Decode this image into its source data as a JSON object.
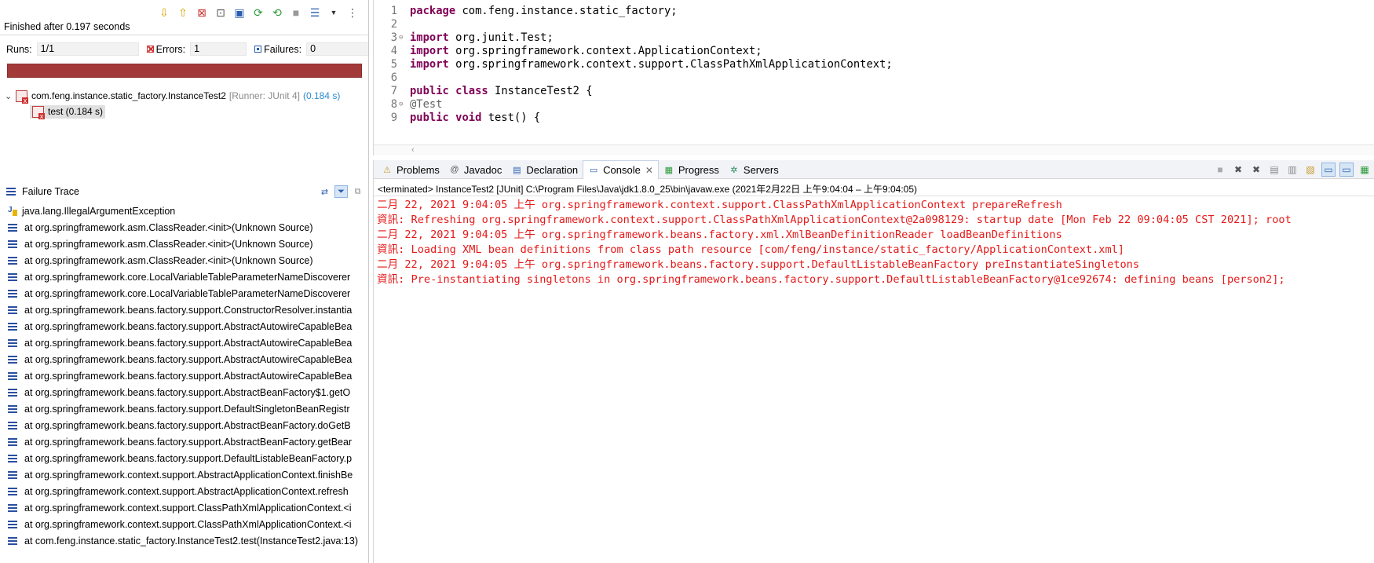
{
  "junit": {
    "finished": "Finished after 0.197 seconds",
    "runs_label": "Runs:",
    "runs_value": "1/1",
    "errors_label": "Errors:",
    "errors_value": "1",
    "failures_label": "Failures:",
    "failures_value": "0",
    "progress_color": "#a33a3a",
    "suite_name": "com.feng.instance.static_factory.InstanceTest2",
    "suite_runner": "[Runner: JUnit 4]",
    "suite_time": "(0.184 s)",
    "test_label": "test (0.184 s)",
    "trace_title": "Failure Trace",
    "exception": "java.lang.IllegalArgumentException",
    "trace": [
      "at org.springframework.asm.ClassReader.<init>(Unknown Source)",
      "at org.springframework.asm.ClassReader.<init>(Unknown Source)",
      "at org.springframework.asm.ClassReader.<init>(Unknown Source)",
      "at org.springframework.core.LocalVariableTableParameterNameDiscoverer",
      "at org.springframework.core.LocalVariableTableParameterNameDiscoverer",
      "at org.springframework.beans.factory.support.ConstructorResolver.instantia",
      "at org.springframework.beans.factory.support.AbstractAutowireCapableBea",
      "at org.springframework.beans.factory.support.AbstractAutowireCapableBea",
      "at org.springframework.beans.factory.support.AbstractAutowireCapableBea",
      "at org.springframework.beans.factory.support.AbstractAutowireCapableBea",
      "at org.springframework.beans.factory.support.AbstractBeanFactory$1.getO",
      "at org.springframework.beans.factory.support.DefaultSingletonBeanRegistr",
      "at org.springframework.beans.factory.support.AbstractBeanFactory.doGetB",
      "at org.springframework.beans.factory.support.AbstractBeanFactory.getBear",
      "at org.springframework.beans.factory.support.DefaultListableBeanFactory.p",
      "at org.springframework.context.support.AbstractApplicationContext.finishBe",
      "at org.springframework.context.support.AbstractApplicationContext.refresh",
      "at org.springframework.context.support.ClassPathXmlApplicationContext.<i",
      "at org.springframework.context.support.ClassPathXmlApplicationContext.<i",
      "at com.feng.instance.static_factory.InstanceTest2.test(InstanceTest2.java:13)"
    ]
  },
  "editor": {
    "lines": [
      {
        "num": "1",
        "parts": [
          {
            "t": "package",
            "c": "kw"
          },
          {
            "t": " com.feng.instance.static_factory;",
            "c": ""
          }
        ]
      },
      {
        "num": "2",
        "parts": []
      },
      {
        "num": "3",
        "fold": true,
        "parts": [
          {
            "t": "import",
            "c": "kw"
          },
          {
            "t": " org.junit.Test;",
            "c": ""
          }
        ]
      },
      {
        "num": "4",
        "parts": [
          {
            "t": "import",
            "c": "kw"
          },
          {
            "t": " org.springframework.context.ApplicationContext;",
            "c": ""
          }
        ]
      },
      {
        "num": "5",
        "parts": [
          {
            "t": "import",
            "c": "kw"
          },
          {
            "t": " org.springframework.context.support.ClassPathXmlApplicationContext;",
            "c": ""
          }
        ]
      },
      {
        "num": "6",
        "parts": []
      },
      {
        "num": "7",
        "parts": [
          {
            "t": "public",
            "c": "kw"
          },
          {
            "t": " ",
            "c": ""
          },
          {
            "t": "class",
            "c": "kw"
          },
          {
            "t": " InstanceTest2 {",
            "c": ""
          }
        ]
      },
      {
        "num": "8",
        "fold": true,
        "parts": [
          {
            "t": "@Test",
            "c": "anno"
          }
        ]
      },
      {
        "num": "9",
        "parts": [
          {
            "t": "public",
            "c": "kw"
          },
          {
            "t": " ",
            "c": ""
          },
          {
            "t": "void",
            "c": "kw"
          },
          {
            "t": " test() {",
            "c": ""
          }
        ]
      }
    ]
  },
  "console": {
    "tabs": [
      {
        "label": "Problems",
        "icon": "problems-icon",
        "glyph": "⚠"
      },
      {
        "label": "Javadoc",
        "icon": "javadoc-icon",
        "glyph": "@"
      },
      {
        "label": "Declaration",
        "icon": "declaration-icon",
        "glyph": "▤"
      },
      {
        "label": "Console",
        "icon": "console-icon",
        "glyph": "▭",
        "active": true
      },
      {
        "label": "Progress",
        "icon": "progress-icon",
        "glyph": "▦"
      },
      {
        "label": "Servers",
        "icon": "servers-icon",
        "glyph": "✲"
      }
    ],
    "terminated": "<terminated> InstanceTest2 [JUnit] C:\\Program Files\\Java\\jdk1.8.0_25\\bin\\javaw.exe  (2021年2月22日 上午9:04:04 – 上午9:04:05)",
    "lines": [
      "二月 22, 2021 9:04:05 上午 org.springframework.context.support.ClassPathXmlApplicationContext prepareRefresh",
      "資訊: Refreshing org.springframework.context.support.ClassPathXmlApplicationContext@2a098129: startup date [Mon Feb 22 09:04:05 CST 2021]; root",
      "二月 22, 2021 9:04:05 上午 org.springframework.beans.factory.xml.XmlBeanDefinitionReader loadBeanDefinitions",
      "資訊: Loading XML bean definitions from class path resource [com/feng/instance/static_factory/ApplicationContext.xml]",
      "二月 22, 2021 9:04:05 上午 org.springframework.beans.factory.support.DefaultListableBeanFactory preInstantiateSingletons",
      "資訊: Pre-instantiating singletons in org.springframework.beans.factory.support.DefaultListableBeanFactory@1ce92674: defining beans [person2];"
    ],
    "text_color": "#e51919"
  }
}
